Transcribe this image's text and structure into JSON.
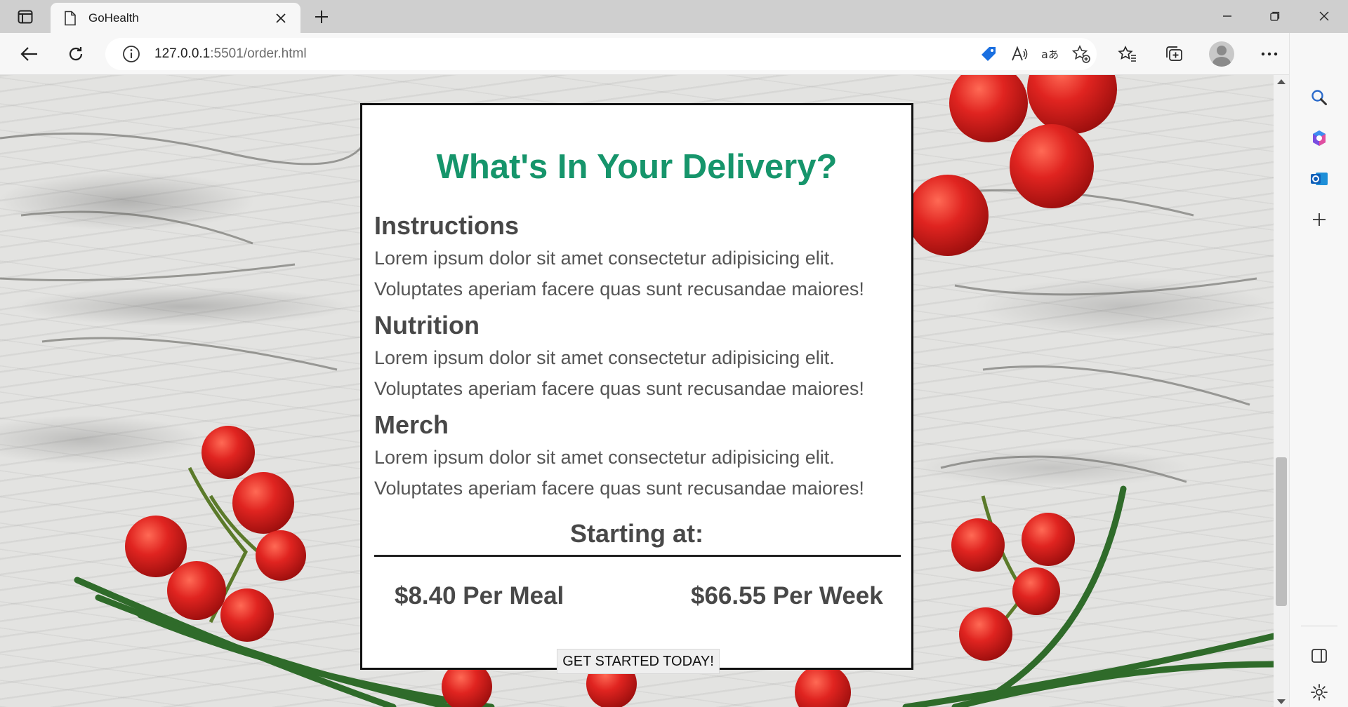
{
  "browser": {
    "tab_title": "GoHealth",
    "url_host": "127.0.0.1",
    "url_rest": ":5501/order.html",
    "toolbar_icons": [
      "back-icon",
      "refresh-icon",
      "info-icon",
      "coupon-tag-icon",
      "read-aloud-icon",
      "translate-icon",
      "add-favorite-icon",
      "favorites-icon",
      "collections-icon",
      "profile-avatar",
      "more-icon",
      "bing-chat-icon"
    ],
    "sidebar_icons": [
      "search-icon",
      "copilot-icon",
      "outlook-icon",
      "add-icon",
      "sidebar-toggle-icon",
      "settings-icon"
    ]
  },
  "card": {
    "title": "What's In Your Delivery?",
    "sections": [
      {
        "heading": "Instructions",
        "line1": "Lorem ipsum dolor sit amet consectetur adipisicing elit.",
        "line2": "Voluptates aperiam facere quas sunt recusandae maiores!"
      },
      {
        "heading": "Nutrition",
        "line1": "Lorem ipsum dolor sit amet consectetur adipisicing elit.",
        "line2": "Voluptates aperiam facere quas sunt recusandae maiores!"
      },
      {
        "heading": "Merch",
        "line1": "Lorem ipsum dolor sit amet consectetur adipisicing elit.",
        "line2": "Voluptates aperiam facere quas sunt recusandae maiores!"
      }
    ],
    "starting_at": "Starting at:",
    "price_meal": "$8.40 Per Meal",
    "price_week": "$66.55 Per Week",
    "cta": "GET STARTED TODAY!"
  },
  "colors": {
    "title_green": "#16956b",
    "text_gray": "#484848",
    "tomato_red": "#d9201c",
    "chive_green": "#2f6b2a"
  }
}
